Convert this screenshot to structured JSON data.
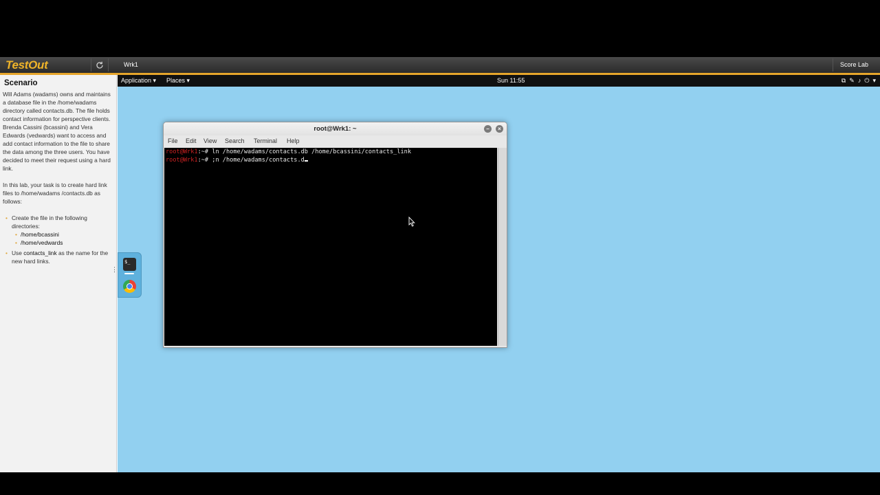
{
  "topbar": {
    "logo": "TestOut",
    "machine_tab": "Wrk1",
    "score_button": "Score Lab"
  },
  "sidebar": {
    "title": "Scenario",
    "paragraph1": "Will Adams (wadams) owns and maintains a database file in the /home/wadams directory called contacts.db. The file holds contact information for perspective clients. Brenda Cassini (bcassini) and Vera Edwards (vedwards) want to access and add contact information to the file to share the data among the three users. You have decided to meet their request using a hard link.",
    "paragraph2": "In this lab, your task is to create hard link files to /home/wadams /contacts.db as follows:",
    "task1": "Create the file in the following directories:",
    "task1_dirs": [
      "/home/bcassini",
      "/home/vedwards"
    ],
    "task2_prefix": "Use ",
    "task2_highlight": "contacts_link",
    "task2_suffix": " as the name for the new hard links."
  },
  "desktop_panel": {
    "application_menu": "Application ▾",
    "places_menu": "Places ▾",
    "clock": "Sun 11:55"
  },
  "terminal": {
    "title": "root@Wrk1: ~",
    "menu": [
      "File",
      "Edit",
      "View",
      "Search",
      "Terminal",
      "Help"
    ],
    "prompt_user": "root@Wrk1",
    "prompt_suffix": ":~# ",
    "line1_command": "ln /home/wadams/contacts.db /home/bcassini/contacts_link",
    "line2_command": ";n /home/wadams/contacts.d"
  },
  "icons": {
    "refresh": "refresh-icon",
    "terminal_app": "terminal-icon",
    "browser_app": "chrome-icon",
    "mouse": "mouse-pointer-icon"
  }
}
